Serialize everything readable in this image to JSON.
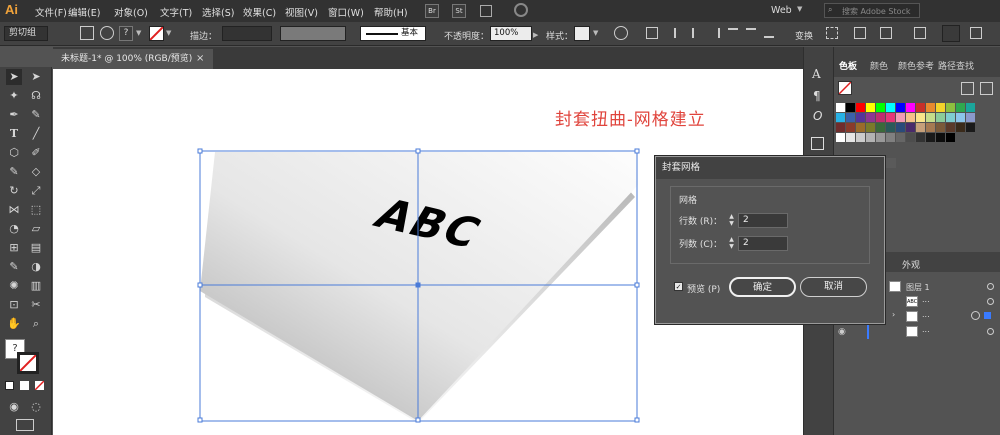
{
  "menubar": {
    "logo": "Ai",
    "items": [
      "文件(F)",
      "编辑(E)",
      "对象(O)",
      "文字(T)",
      "选择(S)",
      "效果(C)",
      "视图(V)",
      "窗口(W)",
      "帮助(H)"
    ],
    "bridge": "Br",
    "stock": "St",
    "workspace": "Web",
    "search_placeholder": "搜索 Adobe Stock"
  },
  "controlbar": {
    "group_label": "剪切组",
    "stroke_label": "描边：",
    "brush_label": "基本",
    "opacity_label": "不透明度：",
    "opacity_value": "100%",
    "style_label": "样式：",
    "transform_label": "变换"
  },
  "document": {
    "tab_title": "未标题-1* @ 100% (RGB/预览)",
    "close": "×"
  },
  "canvas": {
    "heading": "封套扭曲-网格建立",
    "card_text": "ABC"
  },
  "panel": {
    "tabs": [
      "色板",
      "颜色",
      "颜色参考",
      "路径查找"
    ],
    "layers_tab": "外观",
    "layer_name": "图层 1",
    "thumb_text": "ABC",
    "dots": "...",
    "swatch_colors": [
      "#ffffff",
      "#000000",
      "#ff0000",
      "#ffff00",
      "#00ff00",
      "#00ffff",
      "#0000ff",
      "#ff00ff",
      "#c8302a",
      "#e88a2e",
      "#f2d32b",
      "#8dbf3f",
      "#2fa84f",
      "#1aa59b",
      "#28b2e6",
      "#3a61a9",
      "#55349a",
      "#8e3691",
      "#c02d6f",
      "#e5377a",
      "#f39ab5",
      "#f6c18a",
      "#f9e58a",
      "#c6dd8a",
      "#8ccc9a",
      "#7fcdd0",
      "#8cc5ea",
      "#8b9acc",
      "#6f2c2c",
      "#8a3b2a",
      "#9a6b2a",
      "#7a7a2a",
      "#3a6a3a",
      "#2a5a5a",
      "#2a4a7a",
      "#4a2a6a",
      "#c6a07a",
      "#a57a52",
      "#7a5a3a",
      "#5a3a2a",
      "#3a2a1a",
      "#1a1a1a",
      "#ffffff",
      "#e6e6e6",
      "#cccccc",
      "#b3b3b3",
      "#999999",
      "#808080",
      "#666666",
      "#4d4d4d",
      "#333333",
      "#1a1a1a",
      "#0d0d0d",
      "#000000"
    ]
  },
  "dialog": {
    "title": "封套网格",
    "group_label": "网格",
    "rows_label": "行数 (R)：",
    "rows_value": "2",
    "cols_label": "列数 (C)：",
    "cols_value": "2",
    "preview_label": "预览 (P)",
    "ok_label": "确定",
    "cancel_label": "取消"
  },
  "toolbar": {
    "help_glyph": "?"
  }
}
